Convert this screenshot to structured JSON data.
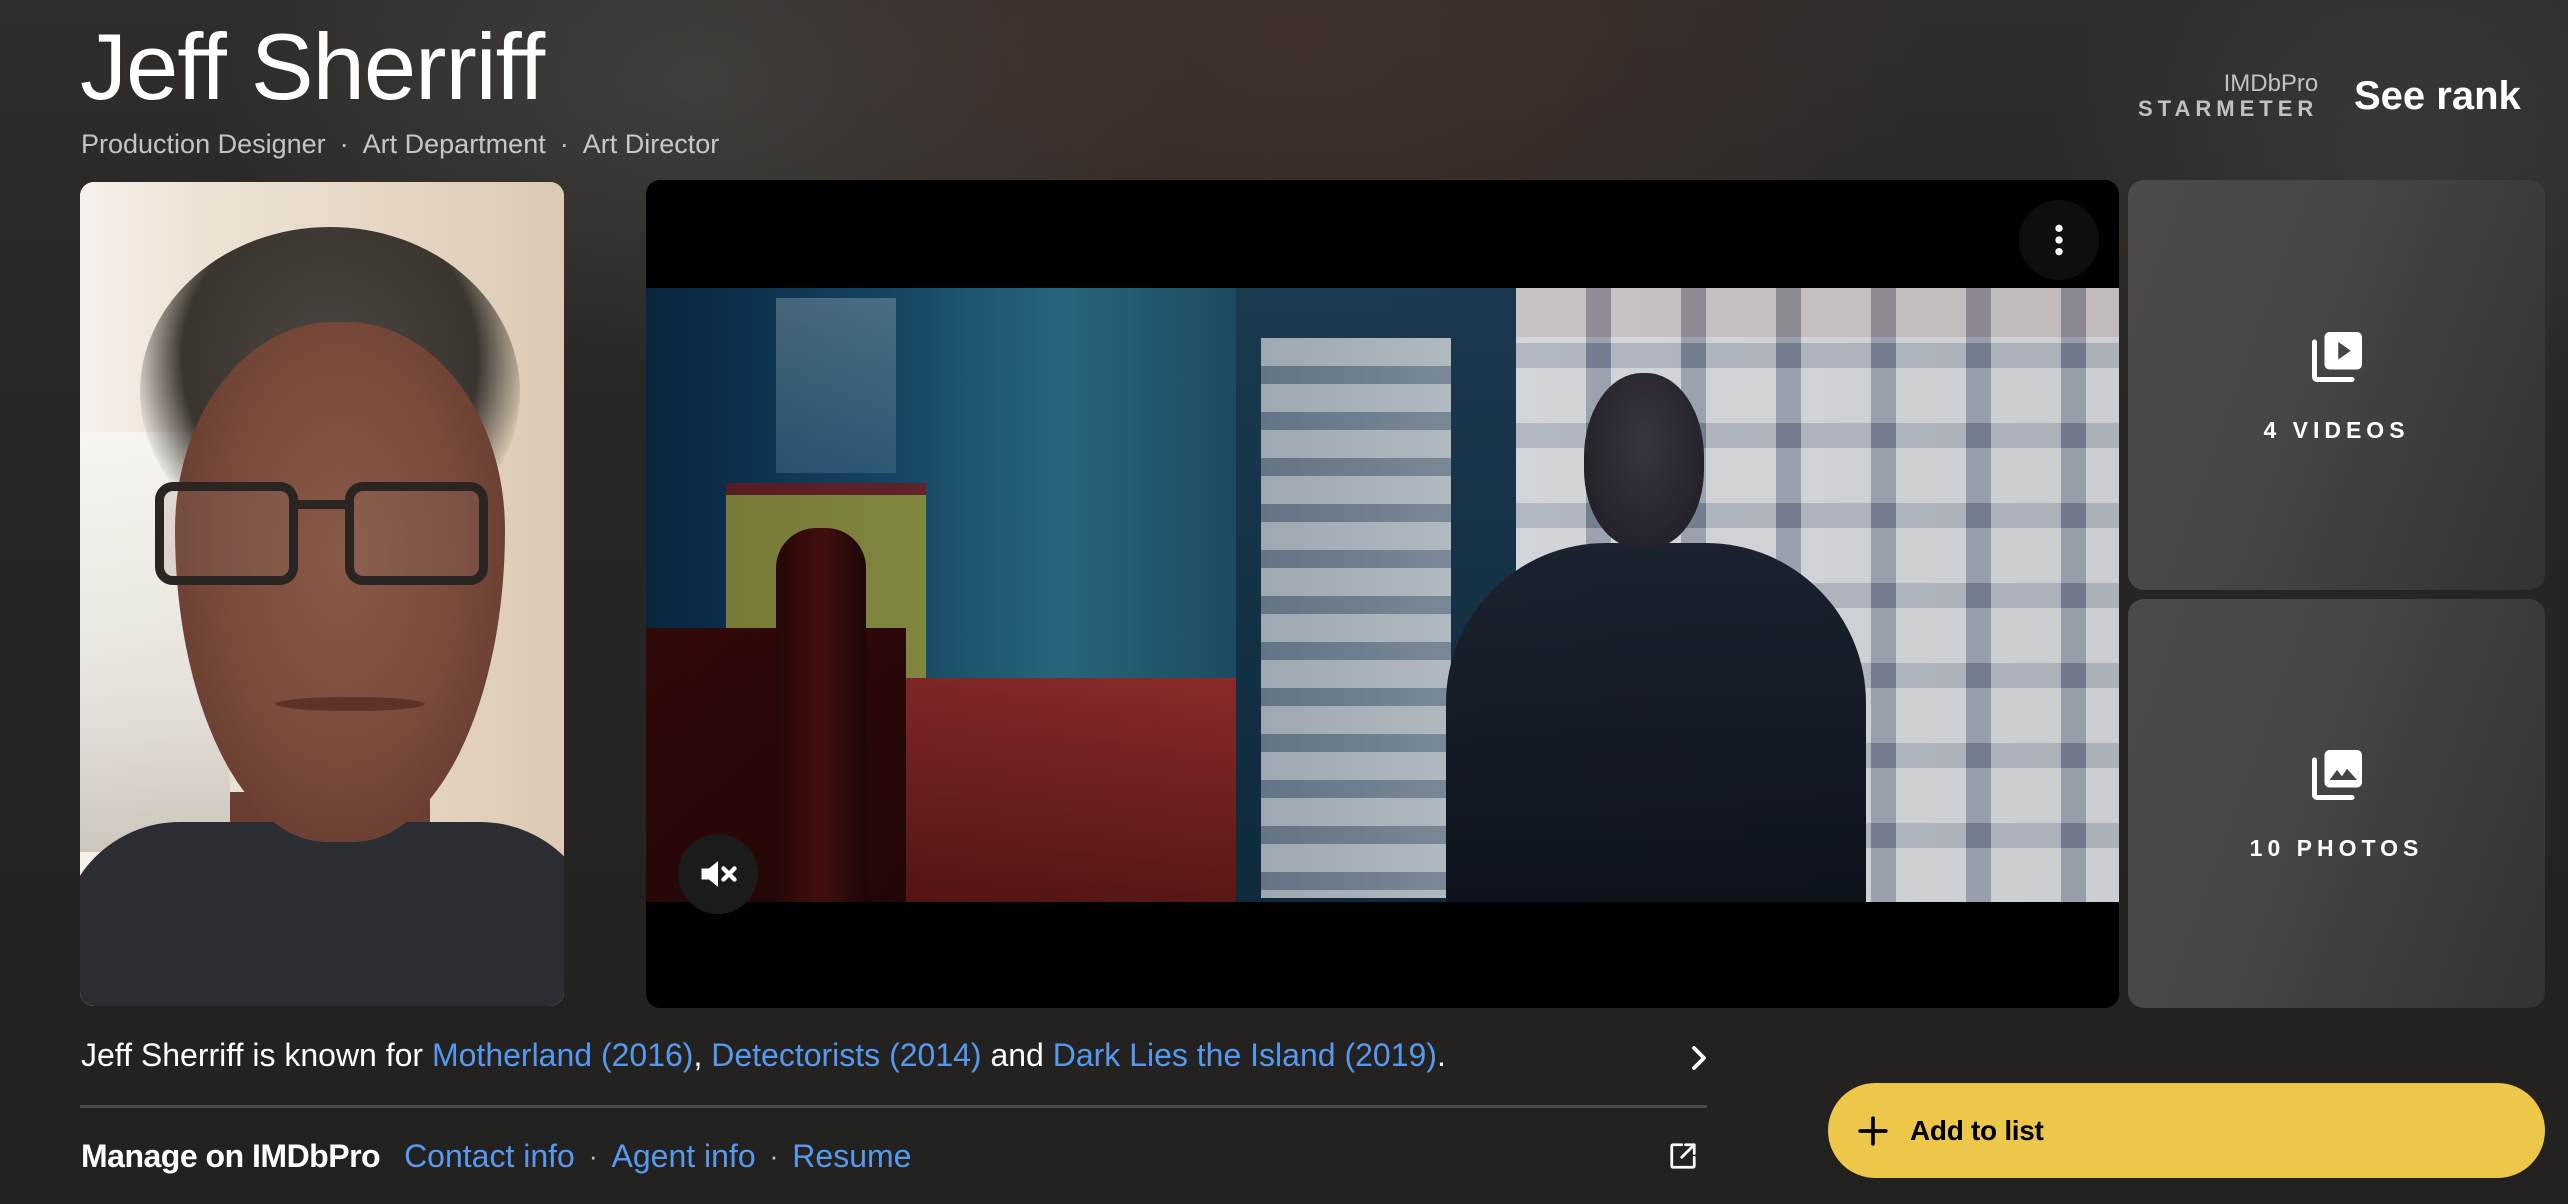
{
  "header": {
    "name": "Jeff Sherriff",
    "roles": [
      "Production Designer",
      "Art Department",
      "Art Director"
    ],
    "role_separator": "·",
    "starmeter": {
      "brand": "IMDbPro",
      "label": "STARMETER",
      "action": "See rank"
    }
  },
  "media": {
    "photo_alt": "Jeff Sherriff",
    "video": {
      "more_icon": "more-vertical-icon",
      "mute_icon": "volume-muted-icon"
    },
    "tiles": [
      {
        "icon": "video-library-icon",
        "label": "4 VIDEOS"
      },
      {
        "icon": "photo-library-icon",
        "label": "10 PHOTOS"
      }
    ]
  },
  "known_for": {
    "prefix": "Jeff Sherriff is known for ",
    "titles": [
      "Motherland (2016)",
      "Detectorists (2014)",
      "Dark Lies the Island (2019)"
    ],
    "sep1": ", ",
    "sep2": " and ",
    "suffix": "."
  },
  "imdbpro": {
    "title": "Manage on IMDbPro",
    "links": [
      "Contact info",
      "Agent info",
      "Resume"
    ],
    "separator": "·"
  },
  "actions": {
    "add_to_list": "Add to list"
  },
  "colors": {
    "link": "#5799ef",
    "accent": "#ecc74a"
  }
}
